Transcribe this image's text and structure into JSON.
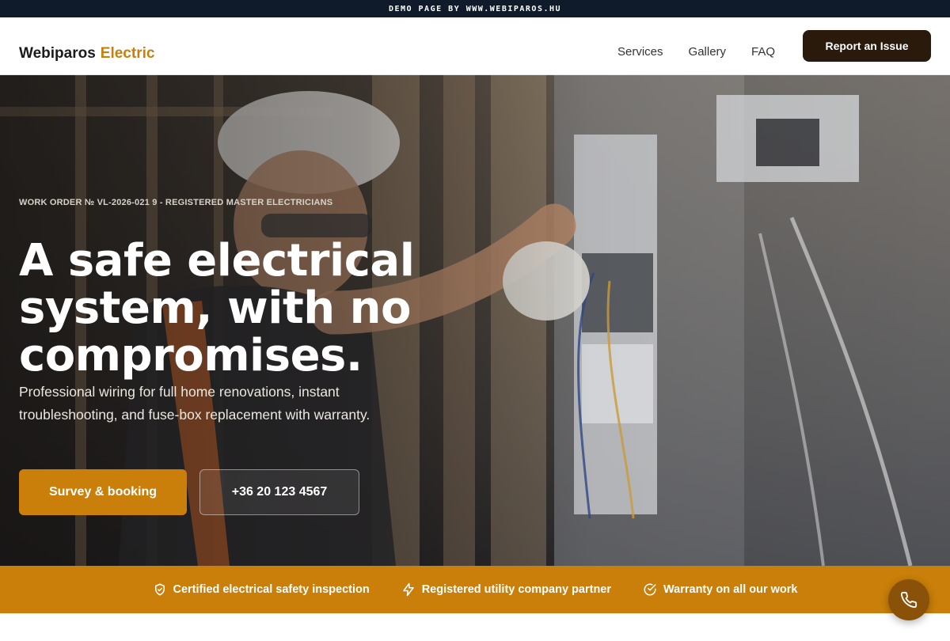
{
  "topbar": {
    "text": "DEMO PAGE BY WWW.WEBIPAROS.HU"
  },
  "brand": {
    "name": "Webiparos",
    "accent": "Electric"
  },
  "nav": {
    "links": [
      "Services",
      "Gallery",
      "FAQ"
    ],
    "cta": "Report an Issue"
  },
  "hero": {
    "eyebrow": "WORK ORDER № VL-2026-021 9 - REGISTERED MASTER ELECTRICIANS",
    "headline": "A safe electrical system, with no compromises.",
    "subline": "Professional wiring for full home renovations, instant troubleshooting, and fuse-box replacement with warranty.",
    "primary_cta": "Survey & booking",
    "phone": "+36 20 123 4567"
  },
  "trust": [
    {
      "icon": "shield-check-icon",
      "label": "Certified electrical safety inspection"
    },
    {
      "icon": "lightning-icon",
      "label": "Registered utility company partner"
    },
    {
      "icon": "check-circle-icon",
      "label": "Warranty on all our work"
    }
  ],
  "colors": {
    "accent": "#c97f09",
    "dark": "#2a1a0c",
    "topbar": "#0f1a2b"
  },
  "fab": {
    "icon": "phone-icon"
  }
}
